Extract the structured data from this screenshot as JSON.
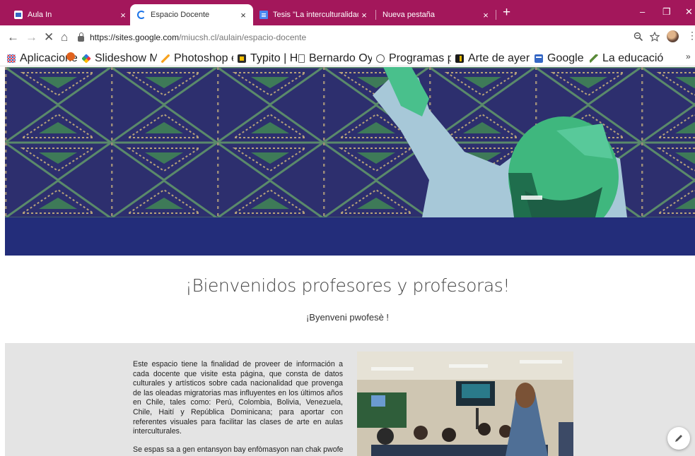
{
  "browser": {
    "tabs": [
      {
        "label": "Aula In",
        "close": "×"
      },
      {
        "label": "Espacio Docente",
        "close": "×"
      },
      {
        "label": "Tesis \"La interculturalidad en el a",
        "close": "×"
      },
      {
        "label": "Nueva pestaña",
        "close": "×"
      }
    ],
    "new_tab": "+",
    "window_controls": {
      "minimize": "–",
      "restore": "❐",
      "close": "✕"
    },
    "url_main": "https://sites.google.com",
    "url_rest": "/miucsh.cl/aulain/espacio-docente",
    "bookmarks": [
      "Aplicaciones",
      "",
      "Slideshow Maker - E",
      "Photoshop en línea e",
      "Typito | Home",
      "Bernardo Oyarzún - A",
      "Programas para edita",
      "Arte de ayer en ento",
      "Google Sites",
      "La educación media"
    ],
    "more_bookmarks": "»",
    "colors": {
      "tab_strip": "#a3175b"
    }
  },
  "page": {
    "heading": "¡Bienvenidos profesores y profesoras!",
    "subheading": "¡Byenveni pwofesè !",
    "paragraph1": "Este espacio tiene la finalidad de proveer de información a cada docente que visite esta página, que consta de datos culturales y artísticos sobre cada nacionalidad que provenga de las oleadas migratorias mas influyentes en los últimos años en Chile, tales como: Perú, Colombia, Bolivia, Venezuela, Chile, Haití y República Dominicana; para aportar con referentes visuales para facilitar las clases de arte en aulas interculturales.",
    "paragraph2": "Se espas sa a gen entansyon bay enfòmasyon nan chak pwofesè",
    "colors": {
      "banner_band": "#232d7a",
      "section_bg": "#e4e4e4"
    }
  }
}
